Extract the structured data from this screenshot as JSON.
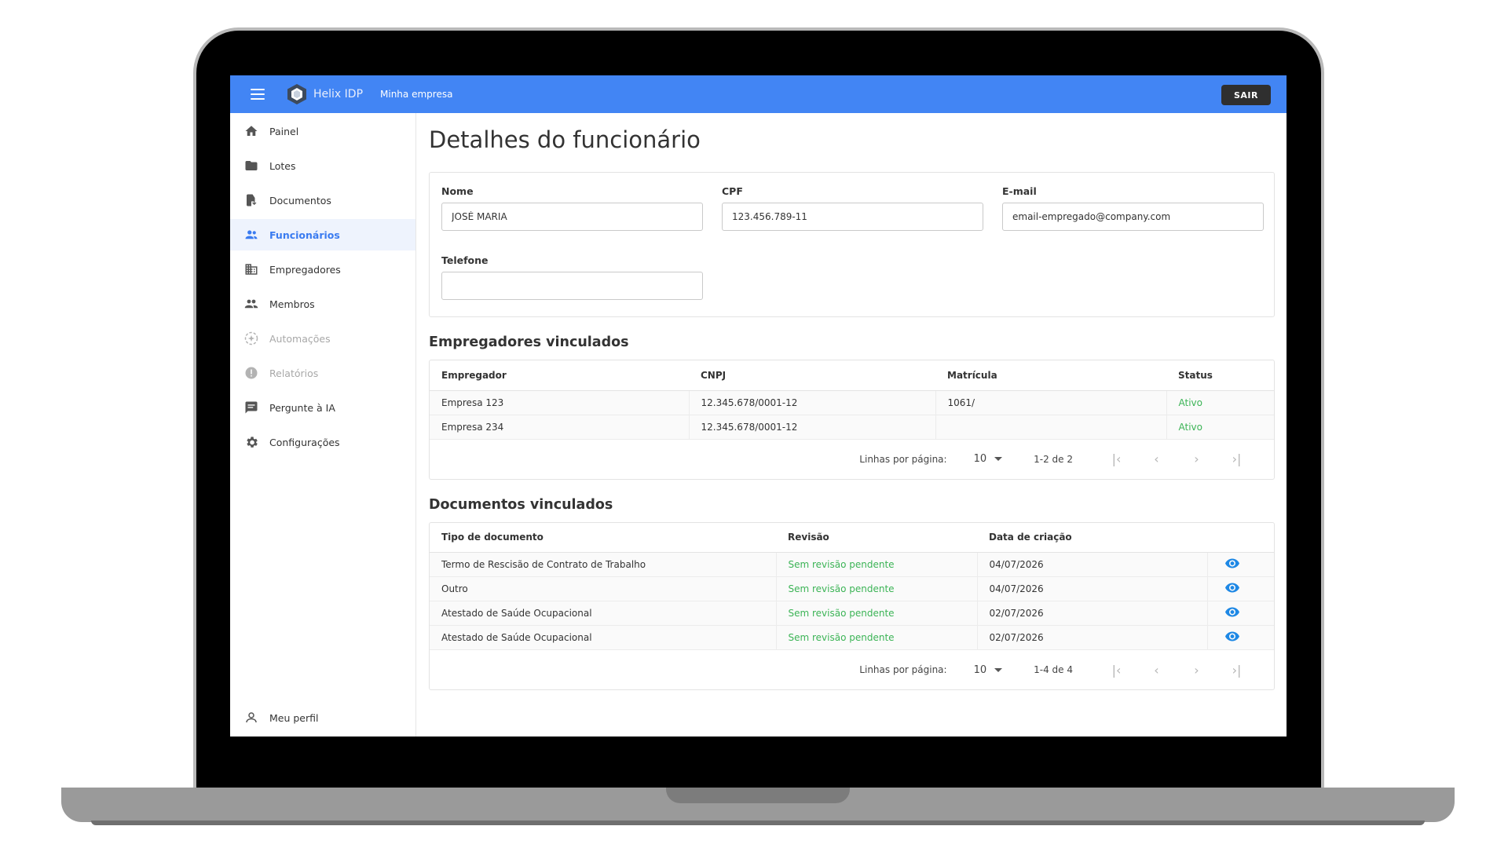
{
  "topbar": {
    "brand": "Helix IDP",
    "company": "Minha empresa",
    "logout_label": "SAIR"
  },
  "sidebar": {
    "items": [
      {
        "label": "Painel",
        "icon": "home-icon",
        "active": false,
        "disabled": false
      },
      {
        "label": "Lotes",
        "icon": "folder-icon",
        "active": false,
        "disabled": false
      },
      {
        "label": "Documentos",
        "icon": "document-icon",
        "active": false,
        "disabled": false
      },
      {
        "label": "Funcionários",
        "icon": "people-icon",
        "active": true,
        "disabled": false
      },
      {
        "label": "Empregadores",
        "icon": "building-icon",
        "active": false,
        "disabled": false
      },
      {
        "label": "Membros",
        "icon": "group-icon",
        "active": false,
        "disabled": false
      },
      {
        "label": "Automações",
        "icon": "automation-icon",
        "active": false,
        "disabled": true
      },
      {
        "label": "Relatórios",
        "icon": "alert-icon",
        "active": false,
        "disabled": true
      },
      {
        "label": "Pergunte à IA",
        "icon": "chat-icon",
        "active": false,
        "disabled": false
      },
      {
        "label": "Configurações",
        "icon": "gear-icon",
        "active": false,
        "disabled": false
      }
    ],
    "profile_label": "Meu perfil"
  },
  "page": {
    "title": "Detalhes do funcionário"
  },
  "form": {
    "name_label": "Nome",
    "name_value": "JOSÉ MARIA",
    "cpf_label": "CPF",
    "cpf_value": "123.456.789-11",
    "email_label": "E-mail",
    "email_value": "email-empregado@company.com",
    "phone_label": "Telefone",
    "phone_value": ""
  },
  "employers": {
    "title": "Empregadores vinculados",
    "headers": [
      "Empregador",
      "CNPJ",
      "Matrícula",
      "Status"
    ],
    "rows": [
      [
        "Empresa 123",
        "12.345.678/0001-12",
        "1061/",
        "Ativo"
      ],
      [
        "Empresa 234",
        "12.345.678/0001-12",
        "",
        "Ativo"
      ]
    ],
    "pager": {
      "rows_label": "Linhas por página:",
      "rows_value": "10",
      "range": "1-2 de 2"
    }
  },
  "documents": {
    "title": "Documentos vinculados",
    "headers": [
      "Tipo de documento",
      "Revisão",
      "Data de criação"
    ],
    "rows": [
      [
        "Termo de Rescisão de Contrato de Trabalho",
        "Sem revisão pendente",
        "04/07/2026"
      ],
      [
        "Outro",
        "Sem revisão pendente",
        "04/07/2026"
      ],
      [
        "Atestado de Saúde Ocupacional",
        "Sem revisão pendente",
        "02/07/2026"
      ],
      [
        "Atestado de Saúde Ocupacional",
        "Sem revisão pendente",
        "02/07/2026"
      ]
    ],
    "pager": {
      "rows_label": "Linhas por página:",
      "rows_value": "10",
      "range": "1-4 de 4"
    }
  },
  "colors": {
    "primary": "#4285f4",
    "active_nav": "#3a7bf0",
    "status_green": "#3cb456",
    "eye_blue": "#1e88e5"
  }
}
